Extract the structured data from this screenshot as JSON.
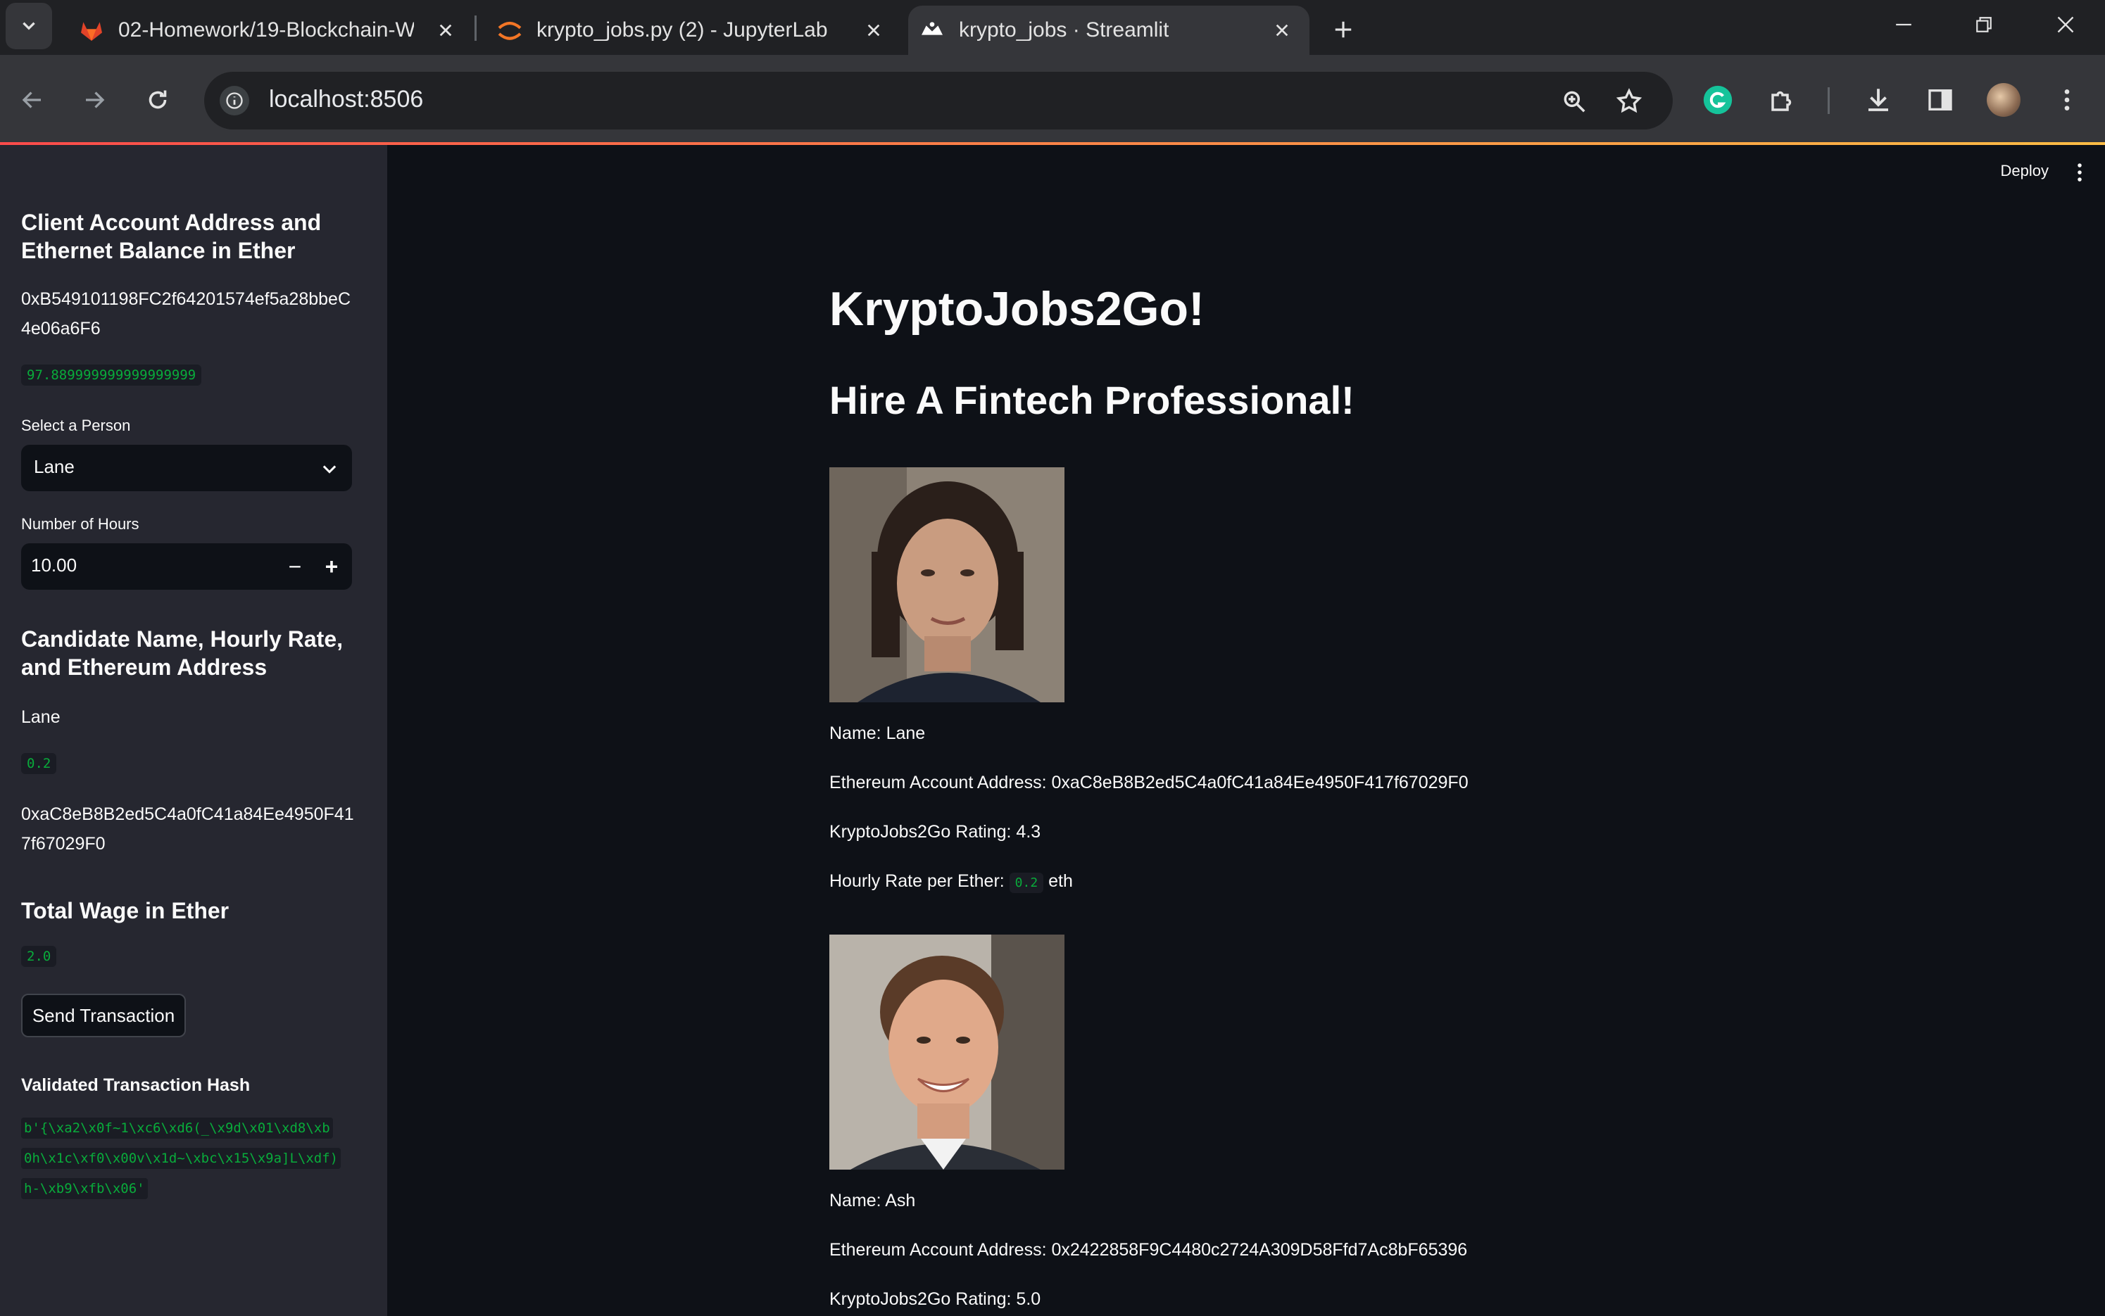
{
  "browser": {
    "tabs": [
      {
        "title": "02-Homework/19-Blockchain-W",
        "icon": "gitlab-icon"
      },
      {
        "title": "krypto_jobs.py (2) - JupyterLab",
        "icon": "jupyter-icon"
      },
      {
        "title": "krypto_jobs · Streamlit",
        "icon": "streamlit-icon",
        "active": true
      }
    ],
    "url": "localhost:8506"
  },
  "sidebar": {
    "account_heading": "Client Account Address and Ethernet Balance in Ether",
    "account_address": "0xB549101198FC2f64201574ef5a28bbeC4e06a6F6",
    "balance": "97.889999999999999999",
    "select_label": "Select a Person",
    "selected_person": "Lane",
    "hours_label": "Number of Hours",
    "hours_value": "10.00",
    "candidate_heading": "Candidate Name, Hourly Rate, and Ethereum Address",
    "candidate_name": "Lane",
    "candidate_rate": "0.2",
    "candidate_address": "0xaC8eB8B2ed5C4a0fC41a84Ee4950F417f67029F0",
    "wage_heading": "Total Wage in Ether",
    "wage_value": "2.0",
    "send_button": "Send Transaction",
    "hash_heading": "Validated Transaction Hash",
    "hash_lines": [
      "b'{\\xa2\\x0f~1\\xc6\\xd6(_\\x9d\\x01\\xd8\\xb",
      "0h\\x1c\\xf0\\x00v\\x1d~\\xbc\\x15\\x9a]L\\xdf)",
      "h-\\xb9\\xfb\\x06'"
    ]
  },
  "main": {
    "deploy": "Deploy",
    "title": "KryptoJobs2Go!",
    "subtitle": "Hire A Fintech Professional!",
    "candidates": [
      {
        "name_line": "Name: Lane",
        "address_line": "Ethereum Account Address: 0xaC8eB8B2ed5C4a0fC41a84Ee4950F417f67029F0",
        "rating_line": "KryptoJobs2Go Rating: 4.3",
        "rate_prefix": "Hourly Rate per Ether:",
        "rate_value": "0.2",
        "rate_suffix": "eth"
      },
      {
        "name_line": "Name: Ash",
        "address_line": "Ethereum Account Address: 0x2422858F9C4480c2724A309D58Ffd7Ac8bF65396",
        "rating_line": "KryptoJobs2Go Rating: 5.0"
      }
    ]
  },
  "colors": {
    "accent": "#ff4b4b",
    "code_green": "#09ab3b",
    "sidebar_bg": "#262730",
    "main_bg": "#0e1117"
  }
}
